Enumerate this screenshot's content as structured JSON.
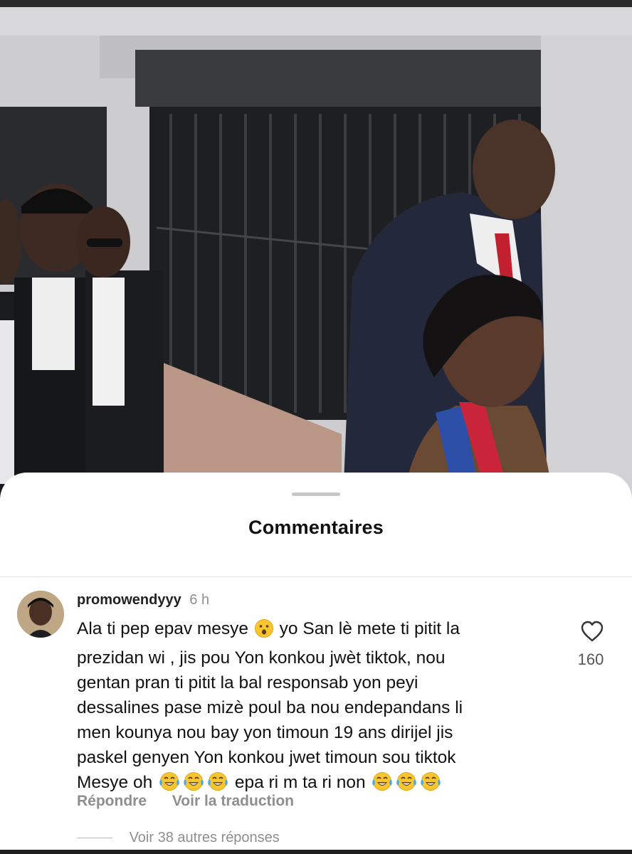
{
  "sheet": {
    "title": "Commentaires"
  },
  "comment": {
    "username": "promowendyyy",
    "time": "6 h",
    "lines": [
      [
        "Ala ti pep epav mesye ",
        "surprised-face",
        " yo San lè mete ti pitit la"
      ],
      [
        "prezidan wi , jis pou Yon konkou jwèt tiktok, nou"
      ],
      [
        "gentan pran ti pitit la bal responsab yon peyi"
      ],
      [
        "dessalines pase mizè poul ba nou endepandans li"
      ],
      [
        "men kounya nou bay yon timoun 19 ans dirijel jis"
      ],
      [
        "paskel genyen Yon konkou jwet timoun sou tiktok"
      ],
      [
        "Mesye oh ",
        "tears-of-joy",
        "tears-of-joy",
        "tears-of-joy",
        " epa ri m ta ri non ",
        "tears-of-joy",
        "tears-of-joy",
        "tears-of-joy"
      ]
    ],
    "like_count": "160",
    "actions": {
      "reply": "Répondre",
      "translate": "Voir la traduction"
    },
    "more_replies": "Voir 38 autres réponses"
  },
  "icons": {
    "like": "heart-outline-icon",
    "avatar": "user-avatar"
  },
  "colors": {
    "sheet_bg": "#ffffff",
    "muted_text": "#8e8e8e",
    "primary_text": "#111111"
  }
}
